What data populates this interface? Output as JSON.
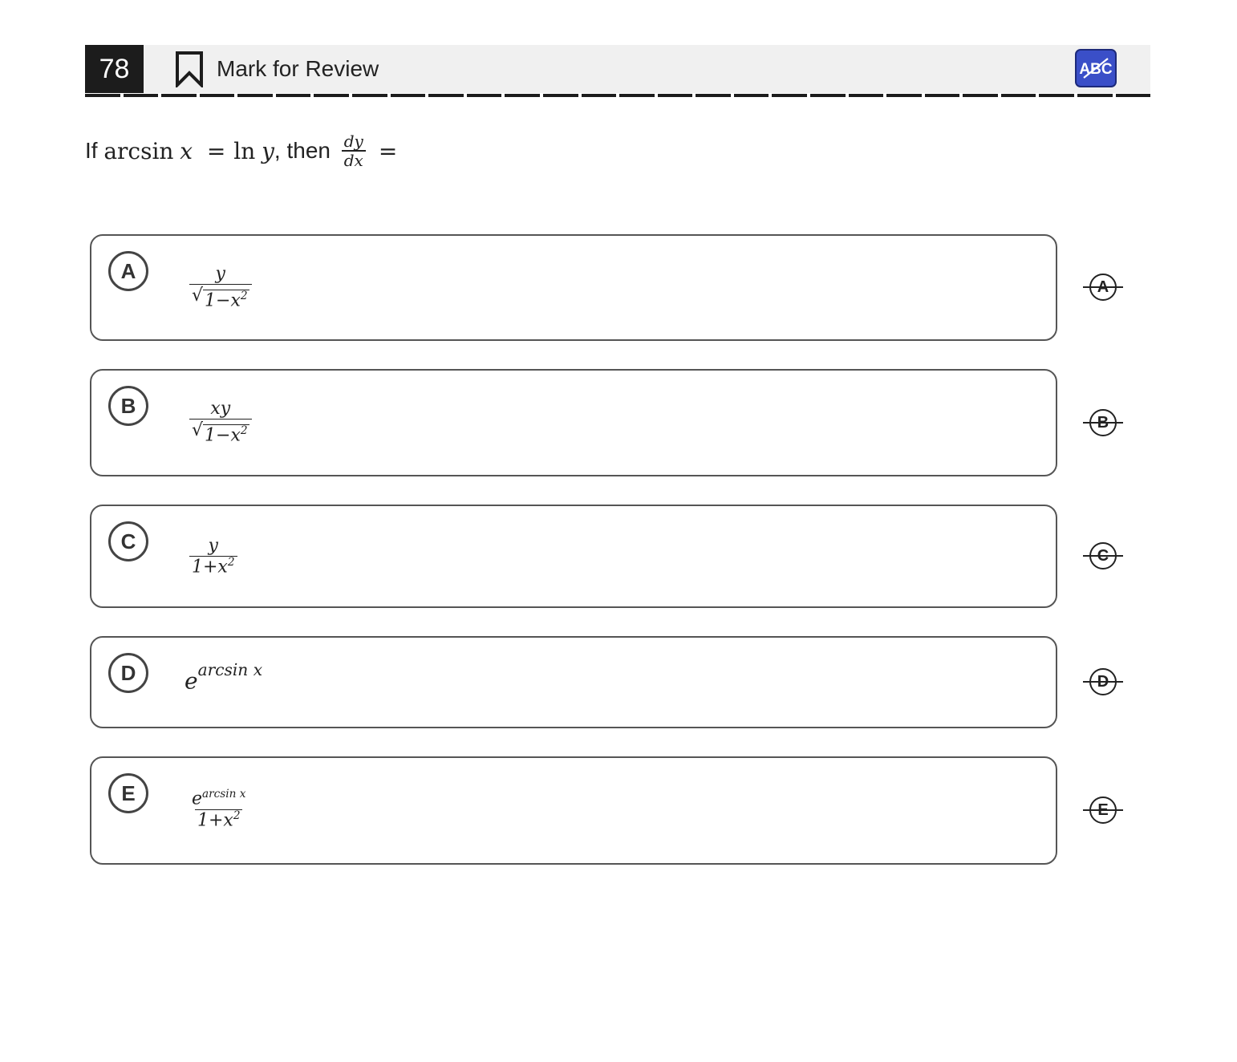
{
  "header": {
    "question_number": "78",
    "mark_for_review_label": "Mark for Review",
    "abc_button_label": "ABC",
    "progress_segments": 28
  },
  "question": {
    "prefix": "If",
    "arcsin": "arcsin",
    "x": "x",
    "equals": "=",
    "ln": "ln",
    "y": "y",
    "then": ", then",
    "dy": "dy",
    "dx": "dx",
    "trailing_equals": "="
  },
  "choices": [
    {
      "letter": "A",
      "numerator": "y",
      "denominator": "1−x",
      "exponent": "2",
      "kind": "sqrt-frac"
    },
    {
      "letter": "B",
      "numerator": "xy",
      "denominator": "1−x",
      "exponent": "2",
      "kind": "sqrt-frac"
    },
    {
      "letter": "C",
      "numerator": "y",
      "denominator": "1+x",
      "exponent": "2",
      "kind": "frac"
    },
    {
      "letter": "D",
      "base": "e",
      "exponent": "arcsin x",
      "kind": "power"
    },
    {
      "letter": "E",
      "numerator_base": "e",
      "numerator_exponent": "arcsin x",
      "denominator": "1+x",
      "exponent": "2",
      "kind": "power-frac"
    }
  ]
}
